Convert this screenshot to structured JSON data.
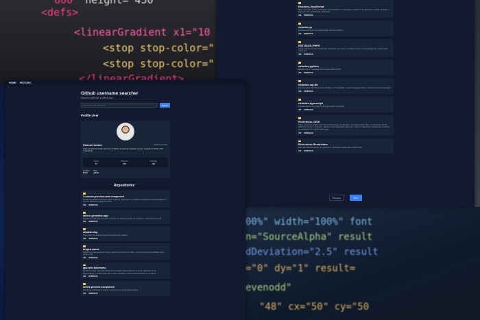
{
  "colors": {
    "accent": "#3b82f6",
    "panel": "#111a2e",
    "card": "#1a2438",
    "folder": "#f2c94c"
  },
  "background": {
    "top_code_lines": [
      "<defs>",
      "<linearGradient x1=\"10",
      "<stop stop-color=\"",
      "<stop stop-color=\"",
      "</linearGradient>"
    ],
    "top_code_first": "height=\"450\"",
    "bottom_code_lines": [
      "00%\" width=\"100%\" font",
      "n=\"SourceAlpha\" result",
      "dDeviation=\"2.5\" result",
      "=\"0\" dy=\"1\" result=",
      "evenodd\"",
      "\"48\" cx=\"50\" cy=\"50"
    ]
  },
  "nav": {
    "home": "HOME",
    "historic": "HISTORIC"
  },
  "header": {
    "title": "Github username searcher",
    "subtitle": "Discover data from a Github user"
  },
  "search": {
    "placeholder": "Search Github username",
    "button": "Search"
  },
  "profile": {
    "section_title": "Profile User",
    "name": "Samuel Amaro",
    "login": "@Samuel-Amaro",
    "bio": "Desenvolvedor Front-End. Que amo codificar. Eu aprendo enquanto escrevo e estudo do HTML, CSS e JavaScript.",
    "stats": [
      {
        "label": "Repos",
        "value": "72"
      },
      {
        "label": "Followers",
        "value": "106"
      },
      {
        "label": "Following",
        "value": "133"
      }
    ],
    "meta": [
      {
        "label": "Location",
        "value": "Brasil"
      },
      {
        "label": "Blog",
        "value": "github"
      }
    ]
  },
  "repos_title": "Repositories",
  "repos_left": [
    {
      "name": "3-column-preview-card-component",
      "desc": "Desafio da plataforma frontend mentor, desafio é desenvolver um cartão de componente de visualização de 3 colunas, utilizando a design fornecido."
    },
    {
      "name": "advice-generator-app",
      "desc": "Desafio de codificação Front-End, contendo um aplicativo gerador de conselhos. Consumindo uma API."
    },
    {
      "name": "alkabot-blog",
      "desc": "Teste prático vaga desenvolvedor Front-End júnior alkabot"
    },
    {
      "name": "blogsd-sanna",
      "desc": "Relatório do blog pessoal de sanna, projeto de estudo de Front-End, com recursos de acessibilidade como design e API."
    },
    {
      "name": "app-web-fotomonto",
      "desc": "Projeto de estudo, para aprendizado de tecnologias relacionadas ao front-end, aplicativo web de fotomontagem, o usuário pode criar, remover, visualizar e ordenar álbuns de fotos em um álbum."
    },
    {
      "name": "article-preview-component",
      "desc": "Desafio de codificação Front-End, componente de visualização de artigo."
    }
  ],
  "repos_right": [
    {
      "name": "Estudos-JavaScript",
      "desc": "Meus exercícios sobre, anotações e aprendizados em JavaScript, a partir fim de aprimorar e melhor aprender a linguagem de programação JavaScript"
    },
    {
      "name": "estudos-js",
      "desc": "Estudos Linguagem de programação JavaScript(ES6+)"
    },
    {
      "name": "ESTUDOS-PHPS",
      "desc": "useful_eight Exercícios de diversas categorias, que foram resolvidos usando uma linguagem de programação. useful_bit"
    },
    {
      "name": "estudos-python",
      "desc": "Estudos sobre a linguagem de Programação Python"
    },
    {
      "name": "estudos-sql-db",
      "desc": "Estudos sobre Data Bases sobre MySQL, O PostgreSQL, usando linguagem SQL e conceitos da teoria de dados"
    },
    {
      "name": "estudos-typescript",
      "desc": "Estudos sobre a Linguagem de Programação Typescript"
    },
    {
      "name": "Exercícios-JAVA",
      "desc": "Neste repositório contém exercícios solucionados na linguagem de programação JAVA, os exercícios são de diferentes temas e conteúdos, alguns contém descrições sobre ele, o foco é melhorar as soluções de exercícios em linguagem de programação JAVA."
    },
    {
      "name": "Exercícios-Resolvidos",
      "desc": "Exercícios Resolvidos(as), Linguagem C, exercícios envolvendo os 30% nível."
    }
  ],
  "repo_links": {
    "url": "URL",
    "homepage": "HOMEPAGE"
  },
  "pager": {
    "previous": "Previous",
    "next": "Next"
  }
}
